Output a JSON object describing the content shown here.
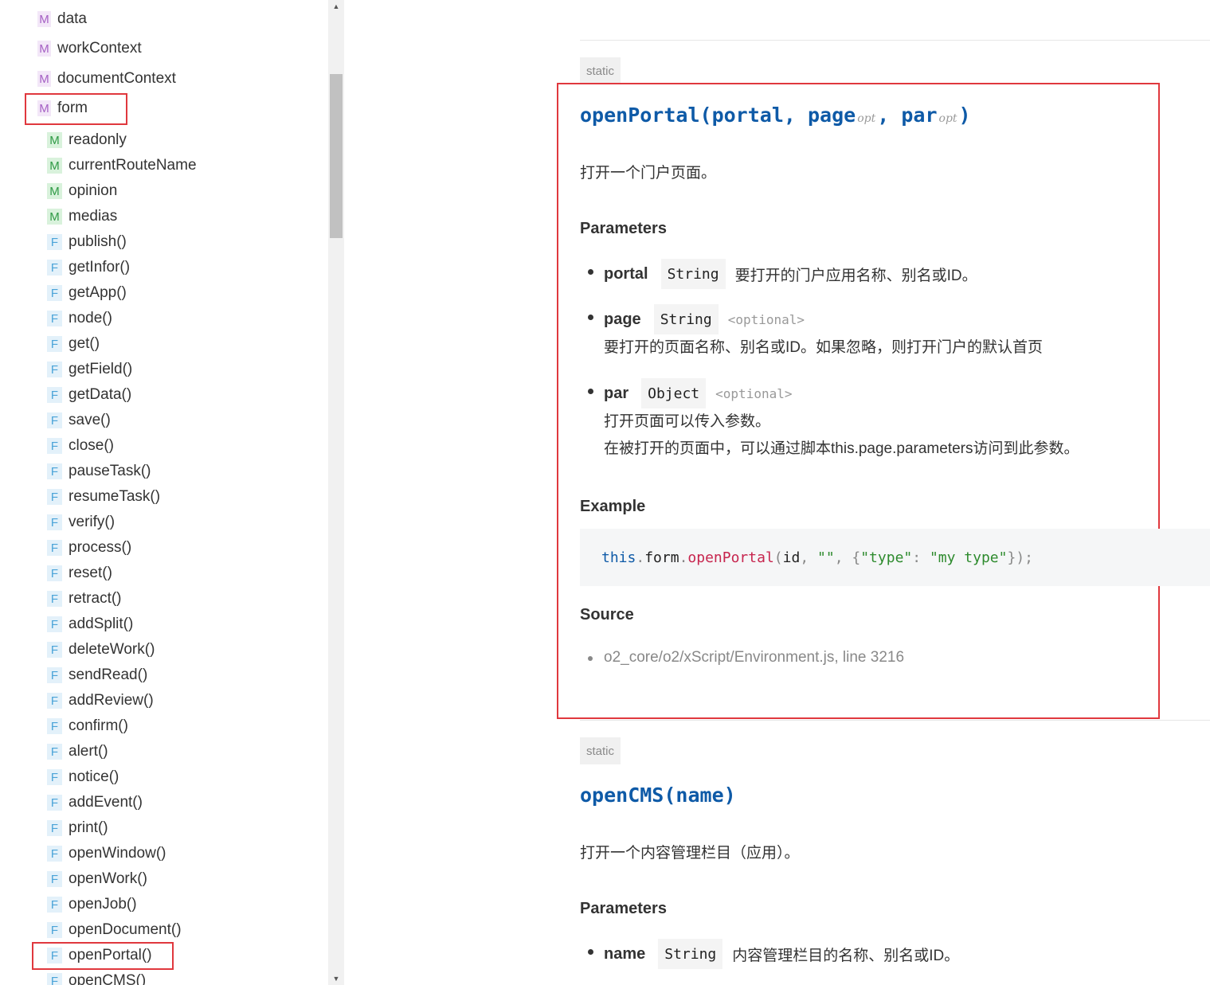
{
  "sidebar": {
    "top_items": [
      {
        "badge": "M",
        "label": "data"
      },
      {
        "badge": "M",
        "label": "workContext"
      },
      {
        "badge": "M",
        "label": "documentContext"
      },
      {
        "badge": "M",
        "label": "form"
      }
    ],
    "child_members": [
      {
        "badge": "M",
        "label": "readonly"
      },
      {
        "badge": "M",
        "label": "currentRouteName"
      },
      {
        "badge": "M",
        "label": "opinion"
      },
      {
        "badge": "M",
        "label": "medias"
      }
    ],
    "functions": [
      {
        "badge": "F",
        "label": "publish()"
      },
      {
        "badge": "F",
        "label": "getInfor()"
      },
      {
        "badge": "F",
        "label": "getApp()"
      },
      {
        "badge": "F",
        "label": "node()"
      },
      {
        "badge": "F",
        "label": "get()"
      },
      {
        "badge": "F",
        "label": "getField()"
      },
      {
        "badge": "F",
        "label": "getData()"
      },
      {
        "badge": "F",
        "label": "save()"
      },
      {
        "badge": "F",
        "label": "close()"
      },
      {
        "badge": "F",
        "label": "pauseTask()"
      },
      {
        "badge": "F",
        "label": "resumeTask()"
      },
      {
        "badge": "F",
        "label": "verify()"
      },
      {
        "badge": "F",
        "label": "process()"
      },
      {
        "badge": "F",
        "label": "reset()"
      },
      {
        "badge": "F",
        "label": "retract()"
      },
      {
        "badge": "F",
        "label": "addSplit()"
      },
      {
        "badge": "F",
        "label": "deleteWork()"
      },
      {
        "badge": "F",
        "label": "sendRead()"
      },
      {
        "badge": "F",
        "label": "addReview()"
      },
      {
        "badge": "F",
        "label": "confirm()"
      },
      {
        "badge": "F",
        "label": "alert()"
      },
      {
        "badge": "F",
        "label": "notice()"
      },
      {
        "badge": "F",
        "label": "addEvent()"
      },
      {
        "badge": "F",
        "label": "print()"
      },
      {
        "badge": "F",
        "label": "openWindow()"
      },
      {
        "badge": "F",
        "label": "openWork()"
      },
      {
        "badge": "F",
        "label": "openJob()"
      },
      {
        "badge": "F",
        "label": "openDocument()"
      },
      {
        "badge": "F",
        "label": "openPortal()"
      },
      {
        "badge": "F",
        "label": "openCMS()"
      }
    ]
  },
  "scrollbar": {
    "up_icon": "triangle-up",
    "down_icon": "triangle-down"
  },
  "colors": {
    "highlight": "#e0383e",
    "signature": "#0e5aa7"
  },
  "sections": [
    {
      "tag": "static",
      "signature": {
        "name": "openPortal",
        "open": "(",
        "p1": "portal",
        "comma1": ", ",
        "p2": "page",
        "opt2": "opt",
        "comma2": ", ",
        "p3": "par",
        "opt3": "opt",
        "close": ")"
      },
      "description": "打开一个门户页面。",
      "params_heading": "Parameters",
      "params": [
        {
          "name": "portal",
          "type": "String",
          "optional": "",
          "desc_inline": "要打开的门户应用名称、别名或ID。",
          "desc_lines": []
        },
        {
          "name": "page",
          "type": "String",
          "optional": "<optional>",
          "desc_inline": "",
          "desc_lines": [
            "要打开的页面名称、别名或ID。如果忽略，则打开门户的默认首页"
          ]
        },
        {
          "name": "par",
          "type": "Object",
          "optional": "<optional>",
          "desc_inline": "",
          "desc_lines": [
            "打开页面可以传入参数。",
            "在被打开的页面中，可以通过脚本this.page.parameters访问到此参数。"
          ]
        }
      ],
      "example_heading": "Example",
      "example_code": {
        "this": "this",
        "dot1": ".",
        "form": "form",
        "dot2": ".",
        "fn": "openPortal",
        "lp": "(",
        "id": "id",
        "c1": ", ",
        "empty_str": "\"\"",
        "c2": ", ",
        "lb": "{",
        "key": "\"type\"",
        "colon": ": ",
        "val": "\"my type\"",
        "rb": "}",
        "rp": ");"
      },
      "source_heading": "Source",
      "source": "o2_core/o2/xScript/Environment.js, line 3216"
    },
    {
      "tag": "static",
      "signature": {
        "name": "openCMS",
        "open": "(",
        "p1": "name",
        "close": ")"
      },
      "description": "打开一个内容管理栏目（应用）。",
      "params_heading": "Parameters",
      "params": [
        {
          "name": "name",
          "type": "String",
          "optional": "",
          "desc_inline": "内容管理栏目的名称、别名或ID。",
          "desc_lines": []
        }
      ]
    }
  ]
}
